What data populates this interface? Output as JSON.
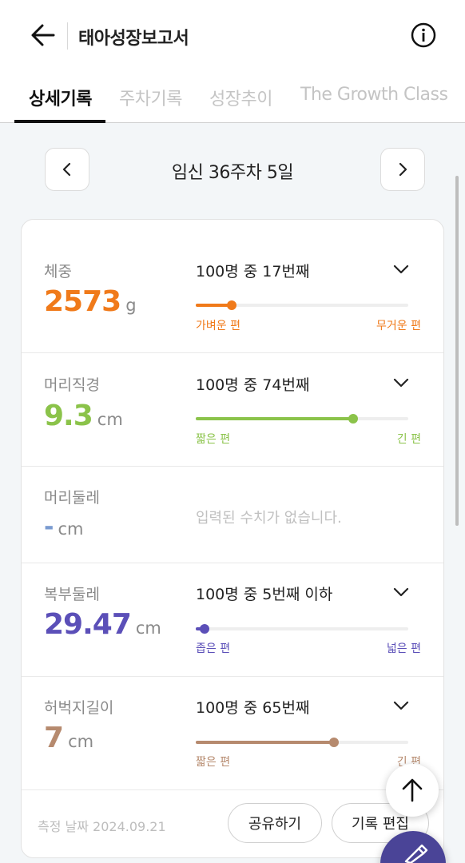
{
  "header": {
    "title": "태아성장보고서"
  },
  "tabs": [
    {
      "label": "상세기록",
      "active": true
    },
    {
      "label": "주차기록"
    },
    {
      "label": "성장추이"
    },
    {
      "label": "The Growth Class"
    }
  ],
  "week_nav": {
    "label": "임신 36주차 5일"
  },
  "measurements": [
    {
      "label": "체중",
      "value": "2573",
      "unit": "g",
      "rank": "100명 중 17번째",
      "percent": 17,
      "left_label": "가벼운 편",
      "right_label": "무거운 편",
      "color": "#f07a1a"
    },
    {
      "label": "머리직경",
      "value": "9.3",
      "unit": "cm",
      "rank": "100명 중 74번째",
      "percent": 74,
      "left_label": "짧은 편",
      "right_label": "긴 편",
      "color": "#8bc34a"
    },
    {
      "label": "머리둘레",
      "value": "-",
      "unit": "cm",
      "no_data": "입력된 수치가 없습니다.",
      "color": "#7a9bd0"
    },
    {
      "label": "복부둘레",
      "value": "29.47",
      "unit": "cm",
      "rank": "100명 중 5번째 이하",
      "percent": 4,
      "left_label": "좁은 편",
      "right_label": "넓은 편",
      "color": "#5b4fb8"
    },
    {
      "label": "허벅지길이",
      "value": "7",
      "unit": "cm",
      "rank": "100명 중 65번째",
      "percent": 65,
      "left_label": "짧은 편",
      "right_label": "긴 편",
      "color": "#b68a6e"
    }
  ],
  "footer": {
    "date": "측정 날짜 2024.09.21",
    "share_label": "공유하기",
    "edit_label": "기록 편집"
  }
}
